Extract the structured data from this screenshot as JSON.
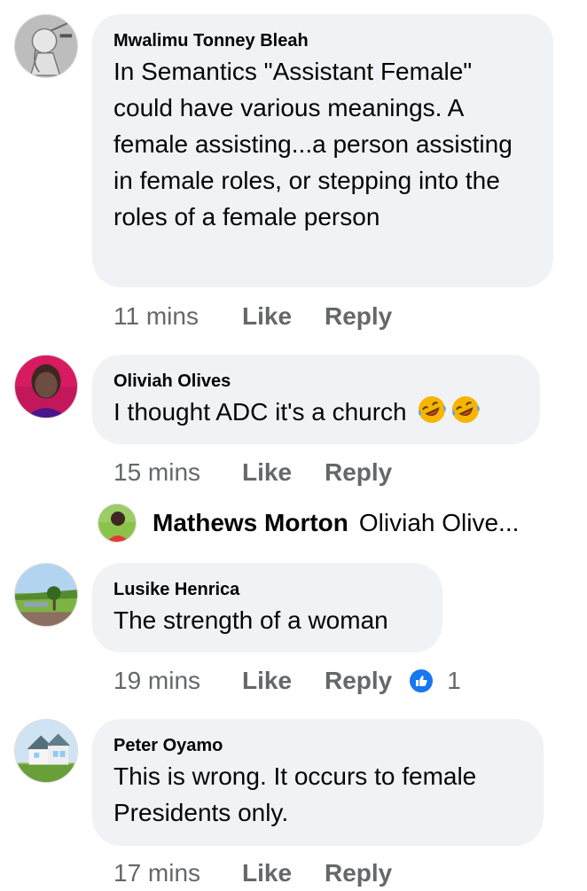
{
  "comments": [
    {
      "author": "Mwalimu Tonney Bleah",
      "text": "In Semantics \"Assistant Female\" could have various meanings. A female assisting...a person assisting in female roles, or stepping into the roles of a female person",
      "time": "11 mins",
      "like_label": "Like",
      "reply_label": "Reply"
    },
    {
      "author": "Oliviah Olives",
      "text": "I thought ADC it's a church",
      "emoji_icons": [
        "rolling-on-floor-laughing-emoji",
        "rolling-on-floor-laughing-emoji"
      ],
      "time": "15 mins",
      "like_label": "Like",
      "reply_label": "Reply",
      "reply_preview": {
        "author": "Mathews Morton",
        "snippet": "Oliviah Olive..."
      }
    },
    {
      "author": "Lusike Henrica",
      "text": "The strength of a woman",
      "time": "19 mins",
      "like_label": "Like",
      "reply_label": "Reply",
      "reaction_icon": "like-thumb-icon",
      "reaction_count": "1"
    },
    {
      "author": "Peter Oyamo",
      "text": "This is wrong. It occurs to female Presidents only.",
      "time": "17 mins",
      "like_label": "Like",
      "reply_label": "Reply"
    }
  ],
  "colors": {
    "bubble": "#f0f2f5",
    "meta_text": "#65676b",
    "like_blue": "#1877f2"
  }
}
